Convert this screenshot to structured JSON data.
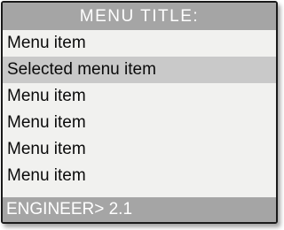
{
  "menu": {
    "title": "MENU TITLE:",
    "items": [
      {
        "label": "Menu item",
        "selected": false
      },
      {
        "label": "Selected menu item",
        "selected": true
      },
      {
        "label": "Menu item",
        "selected": false
      },
      {
        "label": "Menu item",
        "selected": false
      },
      {
        "label": "Menu item",
        "selected": false
      },
      {
        "label": "Menu item",
        "selected": false
      }
    ]
  },
  "status": {
    "text": "ENGINEER> 2.1"
  },
  "colors": {
    "title_background": "#a5a5a5",
    "selected_background": "#c9c9c9",
    "screen_background": "#f1f1ef",
    "text": "#0a0a0a",
    "bar_text": "#ffffff"
  }
}
